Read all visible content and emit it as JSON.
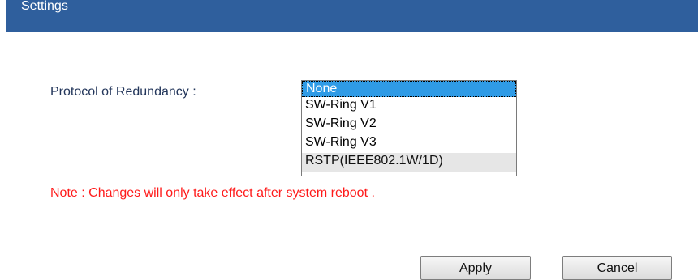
{
  "header": {
    "title": "Settings"
  },
  "form": {
    "redundancy_label": "Protocol of Redundancy :",
    "redundancy_options": [
      "None",
      "SW-Ring V1",
      "SW-Ring V2",
      "SW-Ring V3",
      "RSTP(IEEE802.1W/1D)"
    ],
    "selected": "None",
    "hovered": "RSTP(IEEE802.1W/1D)",
    "note": "Note : Changes will only take effect after system reboot ."
  },
  "buttons": {
    "apply": "Apply",
    "cancel": "Cancel"
  },
  "colors": {
    "header_bg": "#2f5f9d",
    "selection": "#2f9be6",
    "note": "#ff1a1a",
    "label": "#22355a"
  }
}
